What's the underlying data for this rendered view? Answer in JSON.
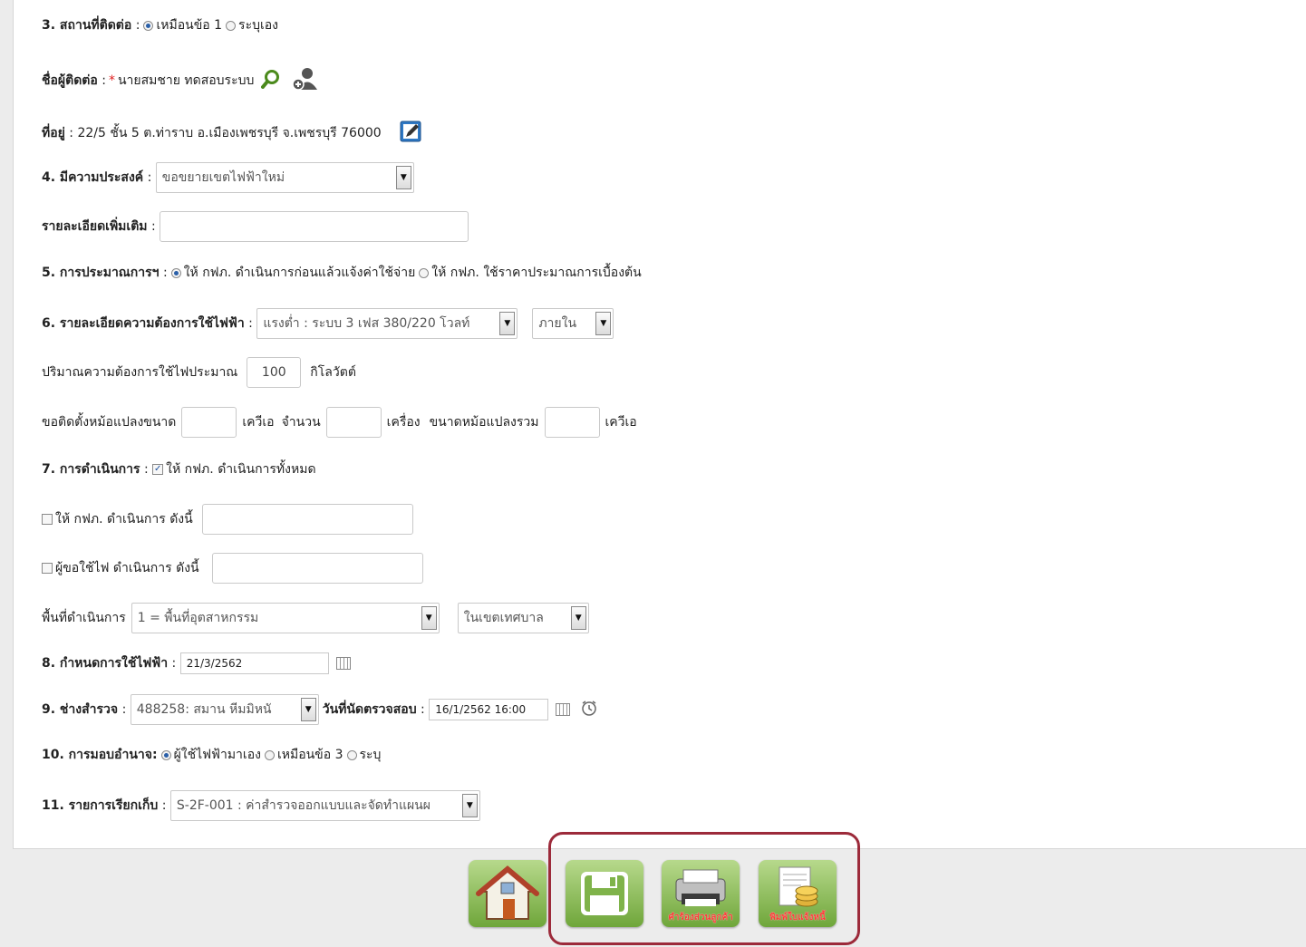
{
  "s3": {
    "label": "3. สถานที่ติดต่อ",
    "opt1": "เหมือนข้อ 1",
    "opt2": "ระบุเอง"
  },
  "contact": {
    "label": "ชื่อผู้ติดต่อ",
    "value": "นายสมชาย ทดสอบระบบ"
  },
  "address": {
    "label": "ที่อยู่",
    "value": "22/5 ชั้น 5 ต.ท่าราบ อ.เมืองเพชรบุรี จ.เพชรบุรี 76000"
  },
  "s4": {
    "label": "4. มีความประสงค์",
    "selected": "ขอขยายเขตไฟฟ้าใหม่"
  },
  "details": {
    "label": "รายละเอียดเพิ่มเติม",
    "value": ""
  },
  "s5": {
    "label": "5. การประมาณการฯ",
    "opt1": "ให้ กฟภ. ดำเนินการก่อนแล้วแจ้งค่าใช้จ่าย",
    "opt2": "ให้ กฟภ. ใช้ราคาประมาณการเบื้องต้น"
  },
  "s6": {
    "label": "6. รายละเอียดความต้องการใช้ไฟฟ้า",
    "voltage": "แรงต่ำ : ระบบ 3 เฟส 380/220 โวลท์",
    "location": "ภายใน"
  },
  "demand": {
    "prefix": "ปริมาณความต้องการใช้ไฟประมาณ",
    "value": "100",
    "unit": "กิโลวัตต์"
  },
  "transformer": {
    "prefix": "ขอติดตั้งหม้อแปลงขนาด",
    "unit1": "เควีเอ",
    "count_label": "จำนวน",
    "unit2": "เครื่อง",
    "total_label": "ขนาดหม้อแปลงรวม",
    "unit3": "เควีเอ"
  },
  "s7": {
    "label": "7. การดำเนินการ",
    "opt": "ให้ กฟภ. ดำเนินการทั้งหมด",
    "opt_pea": "ให้ กฟภ. ดำเนินการ ดังนี้",
    "opt_user": "ผู้ขอใช้ไฟ ดำเนินการ ดังนี้"
  },
  "area": {
    "label": "พื้นที่ดำเนินการ",
    "zone": "1 = พื้นที่อุตสาหกรรม",
    "district": "ในเขตเทศบาล"
  },
  "s8": {
    "label": "8. กำหนดการใช้ไฟฟ้า",
    "date": "21/3/2562"
  },
  "s9": {
    "label": "9. ช่างสำรวจ",
    "surveyor": "488258: สมาน หีมมิหนั",
    "appt_label": "วันที่นัดตรวจสอบ",
    "appt": "16/1/2562 16:00"
  },
  "s10": {
    "label": "10. การมอบอำนาจ:",
    "opt1": "ผู้ใช้ไฟฟ้ามาเอง",
    "opt2": "เหมือนข้อ 3",
    "opt3": "ระบุ"
  },
  "s11": {
    "label": "11. รายการเรียกเก็บ",
    "selected": "S-2F-001 : ค่าสำรวจออกแบบและจัดทำแผนผ"
  },
  "buttons": {
    "request_form": "คำร้องส่วนลูกค้า",
    "invoice": "พิมพ์ใบแจ้งหนี้"
  },
  "colors": {
    "accent_red": "#9c2a3a",
    "button_green": "#6fa63a"
  }
}
